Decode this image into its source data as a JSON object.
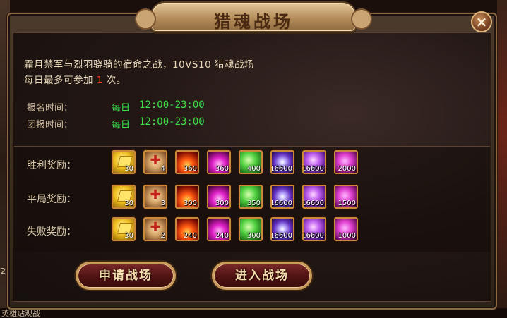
{
  "title": "猎魂战场",
  "close_label": "×",
  "description": {
    "line1": "霜月禁军与烈羽骁骑的宿命之战，10VS10 猎魂战场",
    "line2_prefix": "每日最多可参加",
    "line2_count": "1",
    "line2_suffix": "次。"
  },
  "schedule": [
    {
      "label": "报名时间：",
      "day": "每日",
      "time": "12:00-23:00"
    },
    {
      "label": "团报时间：",
      "day": "每日",
      "time": "12:00-23:00"
    }
  ],
  "rewards": [
    {
      "label": "胜利奖励：",
      "items": [
        {
          "icon": "gold-ingot-icon",
          "count": "30"
        },
        {
          "icon": "medal-icon",
          "count": "4"
        },
        {
          "icon": "fire-soul-icon",
          "count": "360"
        },
        {
          "icon": "purple-flame-icon",
          "count": "360"
        },
        {
          "icon": "emerald-icon",
          "count": "400"
        },
        {
          "icon": "star-crystal-icon",
          "count": "16600"
        },
        {
          "icon": "purple-orb-icon",
          "count": "16600"
        },
        {
          "icon": "purple-jade-icon",
          "count": "2000"
        }
      ]
    },
    {
      "label": "平局奖励：",
      "items": [
        {
          "icon": "gold-ingot-icon",
          "count": "30"
        },
        {
          "icon": "medal-icon",
          "count": "3"
        },
        {
          "icon": "fire-soul-icon",
          "count": "300"
        },
        {
          "icon": "purple-flame-icon",
          "count": "300"
        },
        {
          "icon": "emerald-icon",
          "count": "350"
        },
        {
          "icon": "star-crystal-icon",
          "count": "16600"
        },
        {
          "icon": "purple-orb-icon",
          "count": "16600"
        },
        {
          "icon": "purple-jade-icon",
          "count": "1500"
        }
      ]
    },
    {
      "label": "失败奖励：",
      "items": [
        {
          "icon": "gold-ingot-icon",
          "count": "30"
        },
        {
          "icon": "medal-icon",
          "count": "2"
        },
        {
          "icon": "fire-soul-icon",
          "count": "240"
        },
        {
          "icon": "purple-flame-icon",
          "count": "240"
        },
        {
          "icon": "emerald-icon",
          "count": "300"
        },
        {
          "icon": "star-crystal-icon",
          "count": "16600"
        },
        {
          "icon": "purple-orb-icon",
          "count": "16600"
        },
        {
          "icon": "purple-jade-icon",
          "count": "1000"
        }
      ]
    }
  ],
  "buttons": {
    "apply": "申请战场",
    "enter": "进入战场"
  },
  "background": {
    "bottom_text": "英雄贴观战",
    "left_number": "2"
  },
  "colors": {
    "highlight_red": "#ff3b2a",
    "time_green": "#3ee04a",
    "frame_gold": "#c9883a"
  }
}
